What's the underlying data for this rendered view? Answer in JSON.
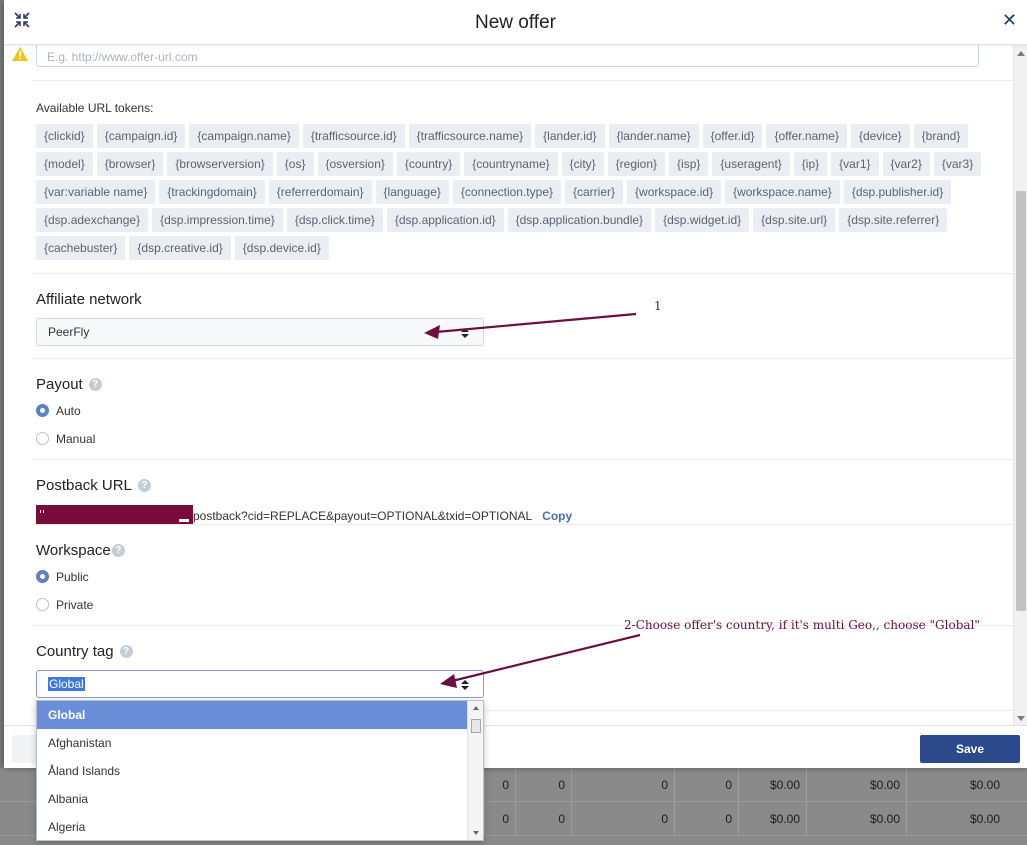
{
  "modal": {
    "title": "New offer"
  },
  "offer_url": {
    "placeholder": "E.g. http://www.offer-url.com"
  },
  "tokens": {
    "label": "Available URL tokens:",
    "items": [
      "{clickid}",
      "{campaign.id}",
      "{campaign.name}",
      "{trafficsource.id}",
      "{trafficsource.name}",
      "{lander.id}",
      "{lander.name}",
      "{offer.id}",
      "{offer.name}",
      "{device}",
      "{brand}",
      "{model}",
      "{browser}",
      "{browserversion}",
      "{os}",
      "{osversion}",
      "{country}",
      "{countryname}",
      "{city}",
      "{region}",
      "{isp}",
      "{useragent}",
      "{ip}",
      "{var1}",
      "{var2}",
      "{var3}",
      "{var:variable name}",
      "{trackingdomain}",
      "{referrerdomain}",
      "{language}",
      "{connection.type}",
      "{carrier}",
      "{workspace.id}",
      "{workspace.name}",
      "{dsp.publisher.id}",
      "{dsp.adexchange}",
      "{dsp.impression.time}",
      "{dsp.click.time}",
      "{dsp.application.id}",
      "{dsp.application.bundle}",
      "{dsp.widget.id}",
      "{dsp.site.url}",
      "{dsp.site.referrer}",
      "{cachebuster}",
      "{dsp.creative.id}",
      "{dsp.device.id}"
    ]
  },
  "affiliate_network": {
    "label": "Affiliate network",
    "value": "PeerFly"
  },
  "payout": {
    "label": "Payout",
    "options": [
      "Auto",
      "Manual"
    ],
    "selected": "Auto"
  },
  "postback": {
    "label": "Postback URL",
    "url_suffix": "postback?cid=REPLACE&payout=OPTIONAL&txid=OPTIONAL",
    "copy_label": "Copy"
  },
  "workspace": {
    "label": "Workspace",
    "options": [
      "Public",
      "Private"
    ],
    "selected": "Public"
  },
  "country_tag": {
    "label": "Country tag",
    "value": "Global",
    "options": [
      "Global",
      "Afghanistan",
      "Åland Islands",
      "Albania",
      "Algeria"
    ]
  },
  "footer": {
    "save_label": "Save"
  },
  "annotations": {
    "note1": "1",
    "note2": "2-Choose offer's country, if it's multi Geo,, choose \"Global\""
  },
  "background_table": {
    "rows": [
      [
        "0",
        "0",
        "0",
        "0",
        "$0.00",
        "$0.00",
        "$0.00"
      ],
      [
        "0",
        "0",
        "0",
        "0",
        "$0.00",
        "$0.00",
        "$0.00"
      ]
    ]
  },
  "colors": {
    "accent": "#5a81c5",
    "save_button": "#2c4a8b",
    "annotation": "#6b0f3f",
    "selected_option": "#6b8ed8"
  }
}
